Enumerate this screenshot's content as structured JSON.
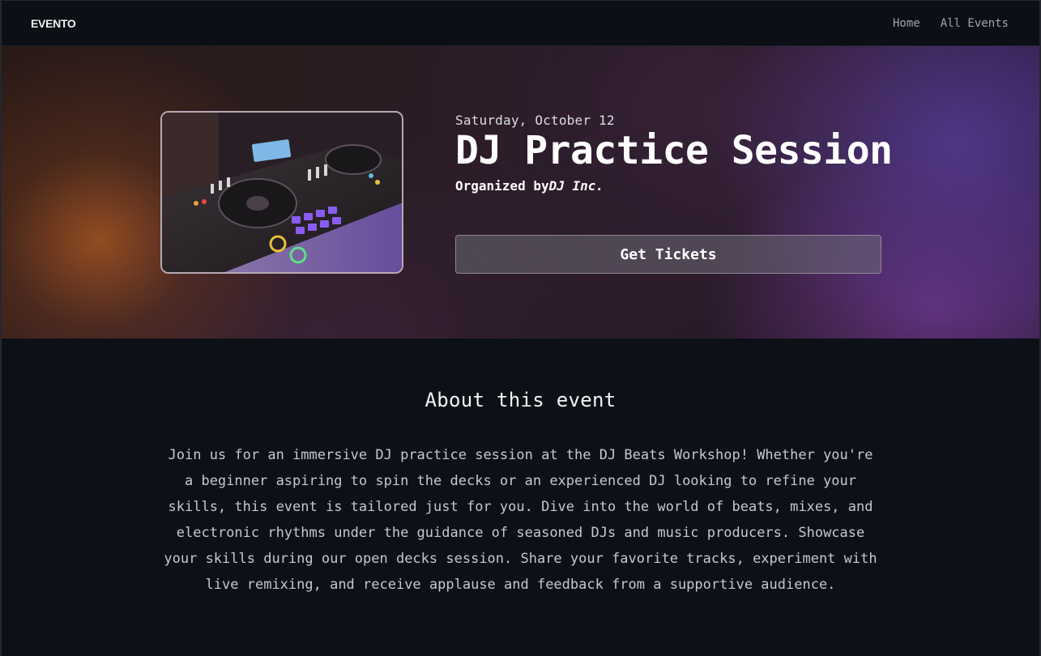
{
  "nav": {
    "logo": "EVENTO",
    "links": [
      "Home",
      "All Events"
    ]
  },
  "event": {
    "date": "Saturday, October 12",
    "title": "DJ Practice Session",
    "organizer_prefix": "Organized by",
    "organizer_name": "DJ Inc.",
    "image_alt": "DJ controller with lit pads",
    "cta_label": "Get Tickets"
  },
  "about": {
    "heading": "About this event",
    "description": "Join us for an immersive DJ practice session at the DJ Beats Workshop! Whether you're a beginner aspiring to spin the decks or an experienced DJ looking to refine your skills, this event is tailored just for you. Dive into the world of beats, mixes, and electronic rhythms under the guidance of seasoned DJs and music producers. Showcase your skills during our open decks session. Share your favorite tracks, experiment with live remixing, and receive applause and feedback from a supportive audience."
  },
  "colors": {
    "background": "#0d1017",
    "hero_warm": "#a45421",
    "hero_cool": "#5c3ea0",
    "button_bg": "#6e6a76"
  }
}
